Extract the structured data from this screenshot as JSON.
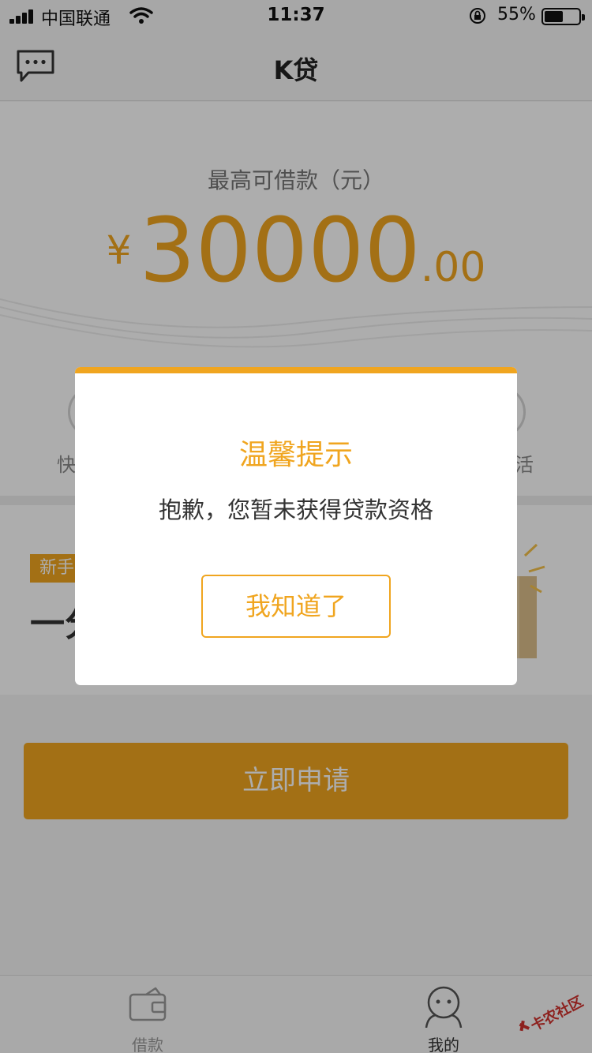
{
  "status_bar": {
    "carrier": "中国联通",
    "time": "11:37",
    "battery_percent": "55%",
    "battery_level": 0.55
  },
  "nav": {
    "title": "K贷",
    "left_icon": "chat-bubble-icon"
  },
  "loan": {
    "label": "最高可借款（元）",
    "currency_symbol": "¥",
    "amount_integer": "30000",
    "amount_decimal": ".00"
  },
  "features": {
    "left_label": "快",
    "right_label": "活"
  },
  "promo": {
    "badge": "新手",
    "title": "一分"
  },
  "apply_button": "立即申请",
  "tabbar": {
    "tabs": [
      {
        "label": "借款",
        "icon": "wallet-icon"
      },
      {
        "label": "我的",
        "icon": "person-icon"
      }
    ]
  },
  "dialog": {
    "title": "温馨提示",
    "message": "抱歉，您暂未获得贷款资格",
    "button": "我知道了"
  },
  "colors": {
    "accent": "#f0a51f",
    "mask": "rgba(0,0,0,0.32)"
  }
}
